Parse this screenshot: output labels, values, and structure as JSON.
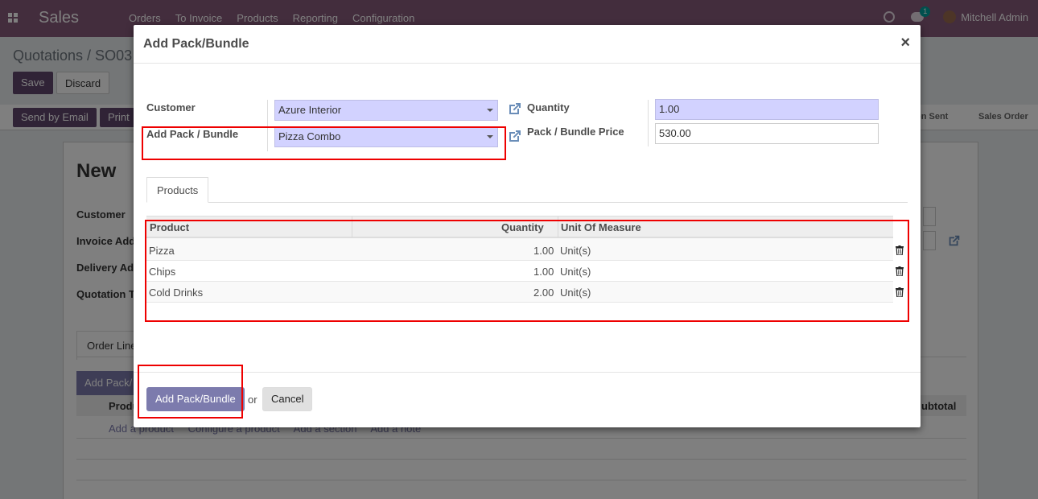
{
  "navbar": {
    "app_name": "Sales",
    "menu": [
      "Orders",
      "To Invoice",
      "Products",
      "Reporting",
      "Configuration"
    ],
    "chat_count": "1",
    "user": "Mitchell Admin"
  },
  "background": {
    "breadcrumb": "Quotations / SO03",
    "save_label": "Save",
    "discard_label": "Discard",
    "send_email_label": "Send by Email",
    "print_label": "Print",
    "status_sent": "on Sent",
    "status_order": "Sales Order",
    "title": "New",
    "labels": [
      "Customer",
      "Invoice Add",
      "Delivery Ad",
      "Quotation T"
    ],
    "tab_label": "Order Line",
    "add_pack_btn": "Add Pack/",
    "col_product": "Produ",
    "col_subtotal": "ubtotal",
    "links": [
      "Add a product",
      "Configure a product",
      "Add a section",
      "Add a note"
    ]
  },
  "modal": {
    "title": "Add Pack/Bundle",
    "close": "×",
    "fields": {
      "customer_label": "Customer",
      "customer_value": "Azure Interior",
      "pack_label": "Add Pack / Bundle",
      "pack_value": "Pizza Combo",
      "quantity_label": "Quantity",
      "quantity_value": "1.00",
      "price_label": "Pack / Bundle Price",
      "price_value": "530.00"
    },
    "tab": "Products",
    "table": {
      "headers": [
        "Product",
        "Quantity",
        "Unit Of Measure"
      ],
      "rows": [
        {
          "product": "Pizza",
          "quantity": "1.00",
          "uom": "Unit(s)"
        },
        {
          "product": "Chips",
          "quantity": "1.00",
          "uom": "Unit(s)"
        },
        {
          "product": "Cold Drinks",
          "quantity": "2.00",
          "uom": "Unit(s)"
        }
      ]
    },
    "footer": {
      "primary_label": "Add Pack/Bundle",
      "or_text": "or",
      "cancel_label": "Cancel"
    }
  },
  "colors": {
    "brand": "#875a7b",
    "primary": "#7c7bad",
    "required_field": "#d2d2ff",
    "highlight": "#ee0000"
  }
}
